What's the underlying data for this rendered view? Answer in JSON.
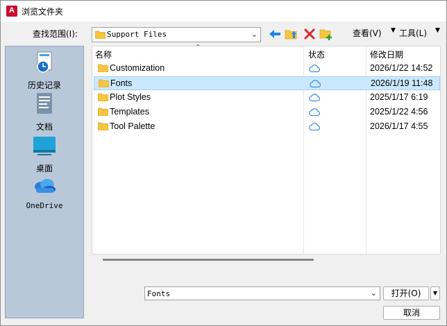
{
  "window": {
    "title": "浏览文件夹",
    "app_icon_letter": "A"
  },
  "lookin": {
    "label": "查找范围(I):",
    "value": "Support Files"
  },
  "toolbar": {
    "back_icon": "back-arrow-icon",
    "up_folder_icon": "up-folder-icon",
    "delete_icon": "delete-icon",
    "new_folder_icon": "new-folder-icon",
    "view_label": "查看(V)",
    "tools_label": "工具(L)"
  },
  "places": [
    {
      "label": "历史记录",
      "icon": "history-icon"
    },
    {
      "label": "文档",
      "icon": "documents-icon"
    },
    {
      "label": "桌面",
      "icon": "desktop-icon"
    },
    {
      "label": "OneDrive",
      "icon": "onedrive-icon"
    }
  ],
  "filelist": {
    "columns": [
      "名称",
      "状态",
      "修改日期"
    ],
    "rows": [
      {
        "name": "Customization",
        "date": "2026/1/22 14:52",
        "selected": false
      },
      {
        "name": "Fonts",
        "date": "2026/1/19 11:48",
        "selected": true
      },
      {
        "name": "Plot Styles",
        "date": "2025/1/17 6:19",
        "selected": false
      },
      {
        "name": "Templates",
        "date": "2025/1/22 4:56",
        "selected": false
      },
      {
        "name": "Tool Palette",
        "date": "2026/1/17 4:55",
        "selected": false
      }
    ]
  },
  "footer": {
    "name_value": "Fonts",
    "open_label": "打开(O)",
    "cancel_label": "取消"
  },
  "colors": {
    "accent": "#0078d7",
    "selection": "#cce8ff",
    "folder": "#f5c542",
    "delete": "#d9262c",
    "places_bg": "#b8c8d8"
  }
}
